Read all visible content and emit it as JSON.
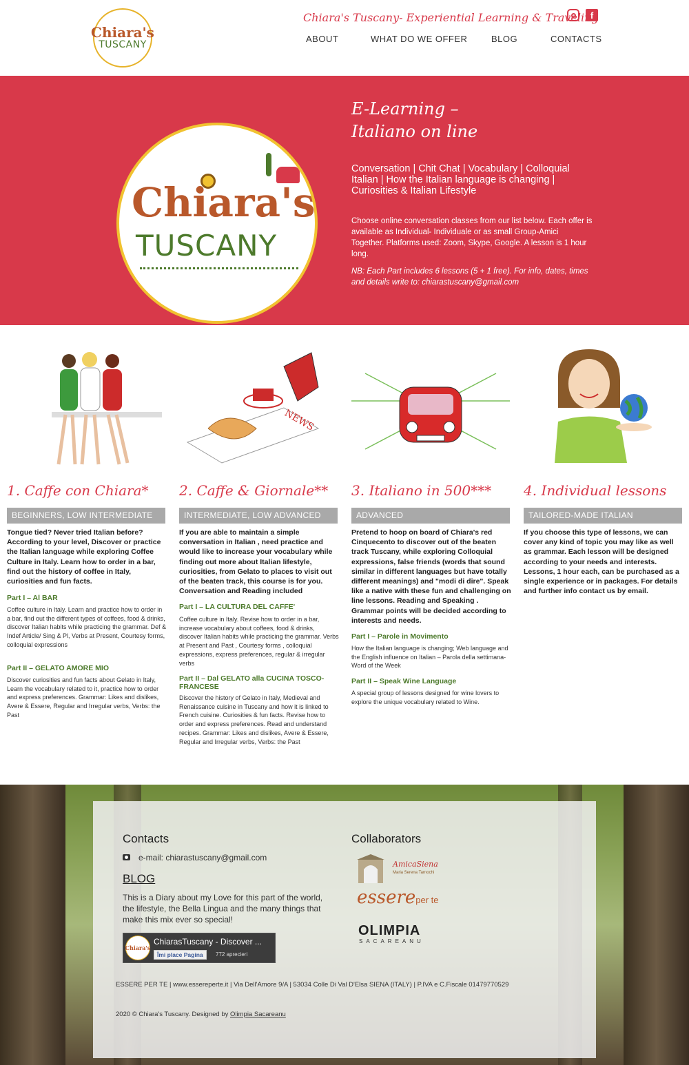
{
  "header": {
    "logo_line1": "Chiara's",
    "logo_line2": "TUSCANY",
    "tagline": "Chiara's Tuscany- Experiential Learning & Traveling",
    "nav": [
      "ABOUT",
      "WHAT DO WE OFFER",
      "BLOG",
      "CONTACTS"
    ],
    "icons": [
      "instagram-icon",
      "facebook-icon"
    ],
    "accent_color": "#d8394a"
  },
  "hero": {
    "logo_line1": "Chiara's",
    "logo_line2": "TUSCANY",
    "title_line1": "E-Learning –",
    "title_line2": "Italiano on line",
    "subtitle": "Conversation | Chit Chat | Vocabulary | Colloquial Italian | How the Italian language is changing | Curiosities & Italian Lifestyle",
    "description": "Choose online conversation classes from our list below. Each offer is available as Individual- Individuale or as small Group-Amici Together. Platforms used: Zoom, Skype, Google. A lesson is 1 hour long.",
    "note": "NB: Each Part includes 6 lessons (5 + 1 free). For info, dates, times and details write to: chiarastuscany@gmail.com",
    "background_color": "#d8394a"
  },
  "courses": [
    {
      "title": "1. Caffe con Chiara*",
      "level": "BEGINNERS, LOW INTERMEDIATE",
      "intro": "Tongue tied? Never tried Italian before? According to your level, Discover or practice the Italian language while exploring Coffee Culture in Italy. Learn how to order in a bar, find out the history of coffee in Italy, curiosities and fun facts.",
      "parts": [
        {
          "title": "Part I – Al BAR",
          "text": "Coffee culture in Italy. Learn and practice how to order in a bar, find out the different types of coffees, food & drinks, discover Italian habits while practicing the grammar. Def & Indef Article/ Sing & Pl, Verbs at Present, Courtesy forms, colloquial expressions"
        },
        {
          "title": "Part II – GELATO AMORE MIO",
          "text": "Discover curiosities and fun facts about Gelato in Italy, Learn the vocabulary related to it, practice how to order and express preferences. Grammar: Likes and dislikes, Avere & Essere, Regular and Irregular verbs, Verbs: the Past"
        }
      ]
    },
    {
      "title": "2. Caffe & Giornale**",
      "level": "INTERMEDIATE, LOW ADVANCED",
      "intro": "If you are able to maintain a simple conversation in Italian , need practice and would like to increase your vocabulary while finding out more about Italian lifestyle, curiosities, from Gelato to places to visit out of the beaten track, this course is for you. Conversation and Reading included",
      "parts": [
        {
          "title": "Part I – LA CULTURA DEL CAFFE'",
          "text": "Coffee culture in Italy. Revise how to order in a bar, increase vocabulary about coffees, food & drinks, discover Italian habits while practicing the grammar. Verbs at Present and Past , Courtesy forms , colloquial expressions, express preferences, regular & irregular verbs"
        },
        {
          "title": "Part II – Dal GELATO alla CUCINA TOSCO-FRANCESE",
          "text": "Discover the history of Gelato in Italy, Medieval and Renaissance cuisine in Tuscany and how it is linked to French cuisine. Curiosities & fun facts. Revise how to order and express preferences. Read and understand recipes. Grammar: Likes and dislikes, Avere & Essere, Regular and Irregular verbs, Verbs: the Past"
        }
      ]
    },
    {
      "title": "3. Italiano in 500***",
      "level": "ADVANCED",
      "intro": "Pretend to hoop on board of Chiara's red Cinquecento to discover out of the beaten track Tuscany, while exploring Colloquial expressions, false friends (words that sound similar in different languages but have totally different meanings) and \"modi di dire\". Speak like a native with these fun and challenging on line lessons. Reading and Speaking . Grammar points will be decided according to interests and needs.",
      "parts": [
        {
          "title": "Part I – Parole in Movimento",
          "text": "How the Italian language is changing; Web language and the English influence on Italian – Parola della settimana- Word of the Week"
        },
        {
          "title": "Part II – Speak Wine Language",
          "text": "A special group of lessons designed for wine lovers to explore the unique vocabulary related to Wine."
        }
      ]
    },
    {
      "title": "4. Individual lessons",
      "level": "TAILORED-MADE ITALIAN",
      "intro": "If you choose this type of lessons, we can cover any kind of topic you may like as well as grammar. Each lesson will be designed according to your needs and interests. Lessons, 1 hour each, can be purchased as a single experience or in packages. For details and further info contact us by email.",
      "parts": []
    }
  ],
  "footer": {
    "contacts_heading": "Contacts",
    "email": "e-mail: chiarastuscany@gmail.com",
    "blog_heading": "BLOG",
    "blog_text": "This is a Diary about my Love for this part of the world, the lifestyle, the Bella Lingua and the many things that make this mix ever so special!",
    "fb_name": "ChiarasTuscany - Discover ...",
    "fb_like": "Îmi place Pagina",
    "fb_count": "772 aprecieri",
    "fb_thumb": "Chiara's",
    "collaborators_heading": "Collaborators",
    "collab_amica_line1": "AmicaSiena",
    "collab_amica_line2": "Maria Serena Tarnochi",
    "collab_essere": "essere",
    "collab_essere_small": "per te",
    "collab_olimpia": "OLIMPIA",
    "collab_olimpia_sub": "SACAREANU",
    "legal": "ESSERE PER TE | www.essereperte.it | Via Dell'Amore 9/A | 53034 Colle Di Val D'Elsa SIENA (ITALY) | P.IVA e C.Fiscale 01479770529",
    "copyright": "2020 © Chiara's Tuscany. Designed by",
    "designer": "Olimpia Sacareanu"
  }
}
